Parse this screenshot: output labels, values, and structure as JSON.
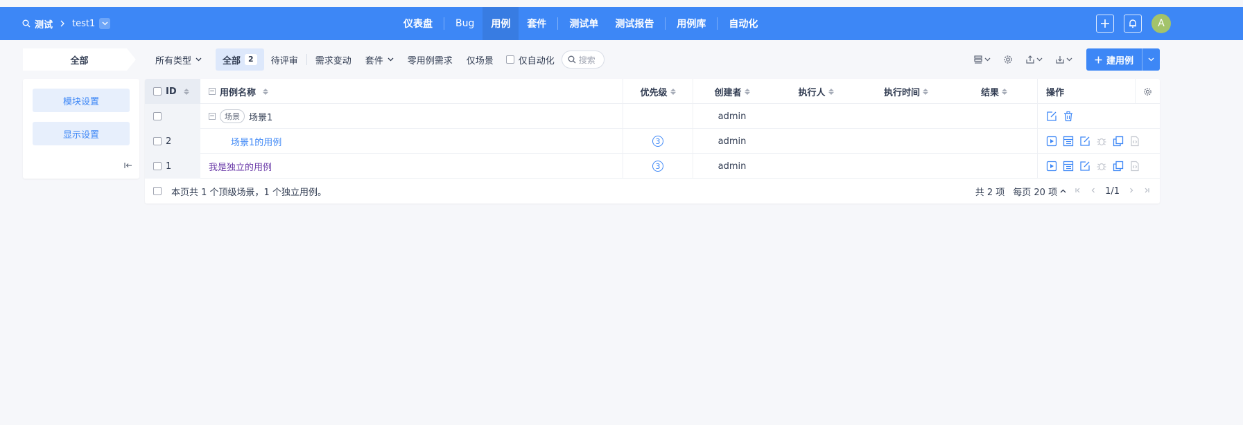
{
  "topbar": {
    "project": "测试",
    "product": "test1",
    "nav": [
      {
        "label": "仪表盘"
      },
      {
        "label": "Bug"
      },
      {
        "label": "用例",
        "active": true
      },
      {
        "label": "套件"
      },
      {
        "label": "测试单"
      },
      {
        "label": "测试报告"
      },
      {
        "label": "用例库"
      },
      {
        "label": "自动化"
      }
    ],
    "avatar": "A",
    "brand_color": "#3d87f6"
  },
  "filter": {
    "module": "全部",
    "type_select": "所有类型",
    "tabs": {
      "all": "全部",
      "all_count": "2",
      "review": "待评审",
      "changed": "需求变动",
      "suite": "套件",
      "zero": "零用例需求",
      "scene": "仅场景"
    },
    "auto_only": "仅自动化",
    "search_placeholder": "搜索",
    "create": "建用例"
  },
  "sidebar": {
    "module_settings": "模块设置",
    "display_settings": "显示设置"
  },
  "table": {
    "headers": {
      "id": "ID",
      "name": "用例名称",
      "priority": "优先级",
      "creator": "创建者",
      "executor": "执行人",
      "exec_time": "执行时间",
      "result": "结果",
      "actions": "操作"
    },
    "rows": [
      {
        "id": "",
        "tag": "场景",
        "name": "场景1",
        "priority": "",
        "creator": "admin"
      },
      {
        "id": "2",
        "name": "场景1的用例",
        "priority": "3",
        "creator": "admin"
      },
      {
        "id": "1",
        "name": "我是独立的用例",
        "priority": "3",
        "creator": "admin"
      }
    ],
    "footer": {
      "summary": "本页共 1 个顶级场景，1 个独立用例。",
      "total": "共 2 项",
      "per_page": "每页 20 项",
      "page": "1/1"
    }
  }
}
